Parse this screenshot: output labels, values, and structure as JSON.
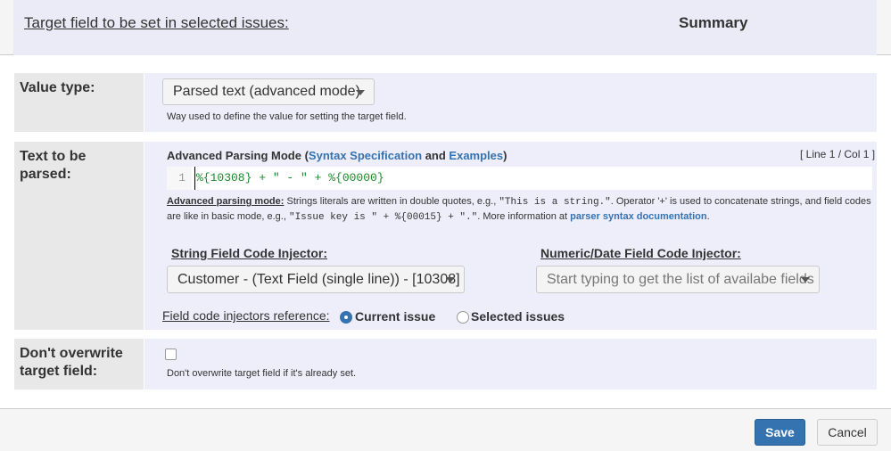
{
  "header": {
    "target_label": "Target field to be set in selected issues:",
    "target_value": "Summary"
  },
  "value_type": {
    "label": "Value type:",
    "selected": "Parsed text (advanced mode)",
    "help": "Way used to define the value for setting the target field."
  },
  "text_to_parse": {
    "label": "Text to be parsed:",
    "title_prefix": "Advanced Parsing Mode (",
    "syntax_link": "Syntax Specification",
    "and": " and ",
    "examples_link": "Examples",
    "title_suffix": ")",
    "cursor_position": "[ Line 1 / Col 1 ]",
    "line_number": "1",
    "code": "%{10308} + \" - \" + %{00000}",
    "help_bold": "Advanced parsing mode:",
    "help_part1": " Strings literals are written in double quotes, e.g., ",
    "help_code1": "\"This is a string.\"",
    "help_part2": ". Operator '+' is used to concatenate strings, and field codes are like in basic mode, e.g., ",
    "help_code2": "\"Issue key is \" + %{00015} + \".\"",
    "help_part3": ". More information at ",
    "help_link": "parser syntax documentation",
    "help_end": "."
  },
  "injectors": {
    "string_label": "String Field Code Injector:",
    "string_selected": "Customer - (Text Field (single line)) - [10308]",
    "numeric_label": "Numeric/Date Field Code Injector:",
    "numeric_placeholder": "Start typing to get the list of availabe fields",
    "reference_label": "Field code injectors reference:",
    "option_current": "Current issue",
    "option_selected": "Selected issues"
  },
  "overwrite": {
    "label_line1": "Don't overwrite",
    "label_line2": "target field:",
    "help": "Don't overwrite target field if it's already set."
  },
  "footer": {
    "save_label": "Save",
    "cancel_label": "Cancel"
  },
  "colors": {
    "accent": "#3572b0",
    "code_green": "#1a8a2a",
    "row_value_bg": "#eeeefb",
    "row_label_bg": "#e8e8e8"
  }
}
